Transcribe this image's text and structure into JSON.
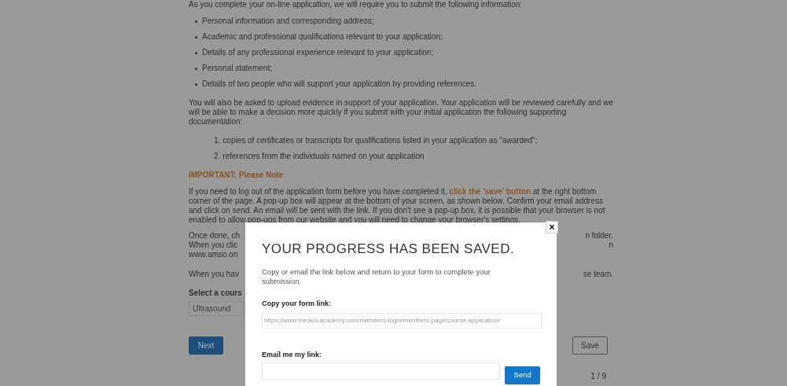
{
  "intro": "As you complete your on-line application, we will require you to submit the following information:",
  "bullets": [
    "Personal information and corresponding address;",
    "Academic and professional qualifications relevant to your application;",
    "Details of any professional experience relevant to your application;",
    "Personal statement;",
    "Details of two people who will support your application by providing references."
  ],
  "evidence_text": "You will also be asked to upload evidence in support of your application. Your application will be reviewed carefully and we will be able to make a decision more quickly if you submit with your initial application the following supporting documentation:",
  "documents": [
    {
      "number": "1.",
      "text": "copies of certificates or transcripts for qualifications listed in your application as \"awarded\";"
    },
    {
      "number": "2.",
      "text": "references from the individuals named on your application"
    }
  ],
  "important_heading": "IMPORTANT: Please Note",
  "save_instructions": "If you need to log out of the application form before you have completed it, **click the 'save' button** at the right bottom corner of the page. A pop-up box will appear at the bottom of your screen, as shown below. Confirm your email address and click on send. An email will be sent with the link. If you don't see a pop-up box, it is possible that your browser is not enabled to allow pop-ups from our website and you will need to change your browser's settings.",
  "partly_hidden_paragraphs": [
    [
      {
        "left": "Once done, ch",
        "right": "n folder."
      },
      {
        "left": "When you clic",
        "right": "n"
      },
      {
        "left": "www.amso.on"
      }
    ],
    [
      {
        "left": "When you hav",
        "right": "se team."
      }
    ]
  ],
  "course_label": "Select a cours",
  "course_value": "Ultrasound",
  "next_button": "Next",
  "save_button": "Save",
  "page_indicator": "1 / 9",
  "modal": {
    "close": "×",
    "title": "YOUR PROGRESS HAS BEEN SAVED.",
    "description": "Copy or email the link below and return to your form to complete your submission.",
    "link_label": "Copy your form link:",
    "link_value": "https://www.meded-academy.com/members-login/members-page/course-application/",
    "email_label": "Email me my link:",
    "send_button": "Send"
  }
}
